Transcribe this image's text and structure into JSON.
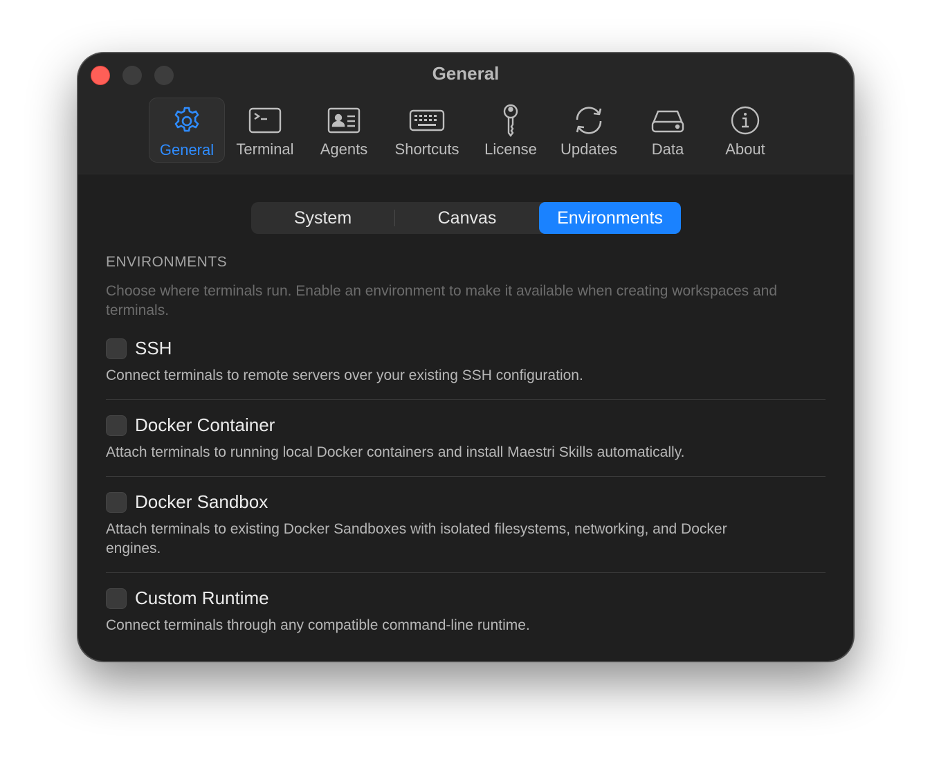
{
  "window": {
    "title": "General"
  },
  "toolbar": {
    "items": [
      {
        "label": "General",
        "icon": "gear-icon",
        "active": true
      },
      {
        "label": "Terminal",
        "icon": "terminal-icon"
      },
      {
        "label": "Agents",
        "icon": "contact-card-icon"
      },
      {
        "label": "Shortcuts",
        "icon": "keyboard-icon"
      },
      {
        "label": "License",
        "icon": "key-icon"
      },
      {
        "label": "Updates",
        "icon": "refresh-icon"
      },
      {
        "label": "Data",
        "icon": "drive-icon"
      },
      {
        "label": "About",
        "icon": "info-icon"
      }
    ]
  },
  "tabs": {
    "items": [
      {
        "label": "System"
      },
      {
        "label": "Canvas"
      },
      {
        "label": "Environments",
        "active": true
      }
    ]
  },
  "section": {
    "title": "ENVIRONMENTS",
    "description": "Choose where terminals run. Enable an environment to make it available when creating workspaces and terminals."
  },
  "environments": [
    {
      "name": "SSH",
      "description": "Connect terminals to remote servers over your existing SSH configuration.",
      "checked": false
    },
    {
      "name": "Docker Container",
      "description": "Attach terminals to running local Docker containers and install Maestri Skills automatically.",
      "checked": false
    },
    {
      "name": "Docker Sandbox",
      "description": "Attach terminals to existing Docker Sandboxes with isolated filesystems, networking, and Docker engines.",
      "checked": false
    },
    {
      "name": "Custom Runtime",
      "description": "Connect terminals through any compatible command-line runtime.",
      "checked": false
    }
  ],
  "colors": {
    "accent": "#1a82ff",
    "close": "#ff5f57",
    "background": "#1f1f1f"
  }
}
